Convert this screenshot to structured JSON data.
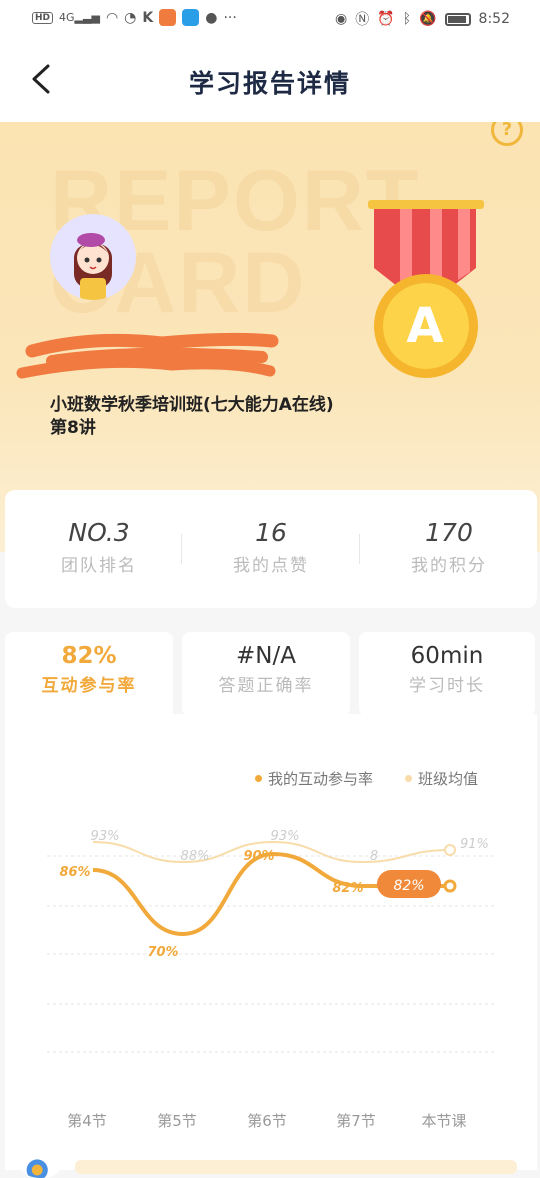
{
  "status_bar": {
    "time": "8:52",
    "network": "4G",
    "hd": "HD"
  },
  "nav": {
    "title": "学习报告详情"
  },
  "hero": {
    "watermark_line1": "REPORT",
    "watermark_line2": "CARD",
    "student_name": "",
    "course_line1": "小班数学秋季培训班(七大能力A在线)",
    "course_line2": "第8讲",
    "grade": "A",
    "help_icon": "?"
  },
  "stats": [
    {
      "value": "NO.3",
      "label": "团队排名"
    },
    {
      "value": "16",
      "label": "我的点赞"
    },
    {
      "value": "170",
      "label": "我的积分"
    }
  ],
  "tabs": [
    {
      "value": "82%",
      "label": "互动参与率",
      "active": true
    },
    {
      "value": "#N/A",
      "label": "答题正确率",
      "active": false
    },
    {
      "value": "60min",
      "label": "学习时长",
      "active": false
    }
  ],
  "chart_data": {
    "type": "line",
    "categories": [
      "第4节",
      "第5节",
      "第6节",
      "第7节",
      "本节课"
    ],
    "series": [
      {
        "name": "我的互动参与率",
        "values": [
          86,
          70,
          90,
          82,
          82
        ],
        "labels": [
          "86%",
          "70%",
          "90%",
          "82%",
          "82%"
        ],
        "color": "#f2a93b"
      },
      {
        "name": "班级均值",
        "values": [
          93,
          88,
          93,
          88,
          91
        ],
        "labels": [
          "93%",
          "88%",
          "93%",
          "8",
          "91%"
        ],
        "color": "#f8dcaa"
      }
    ],
    "highlight_label": "82%",
    "grid": true
  },
  "colors": {
    "accent": "#f2a93b",
    "hero_bg": "#fbe3b2",
    "avg_line": "#f8dcaa"
  }
}
